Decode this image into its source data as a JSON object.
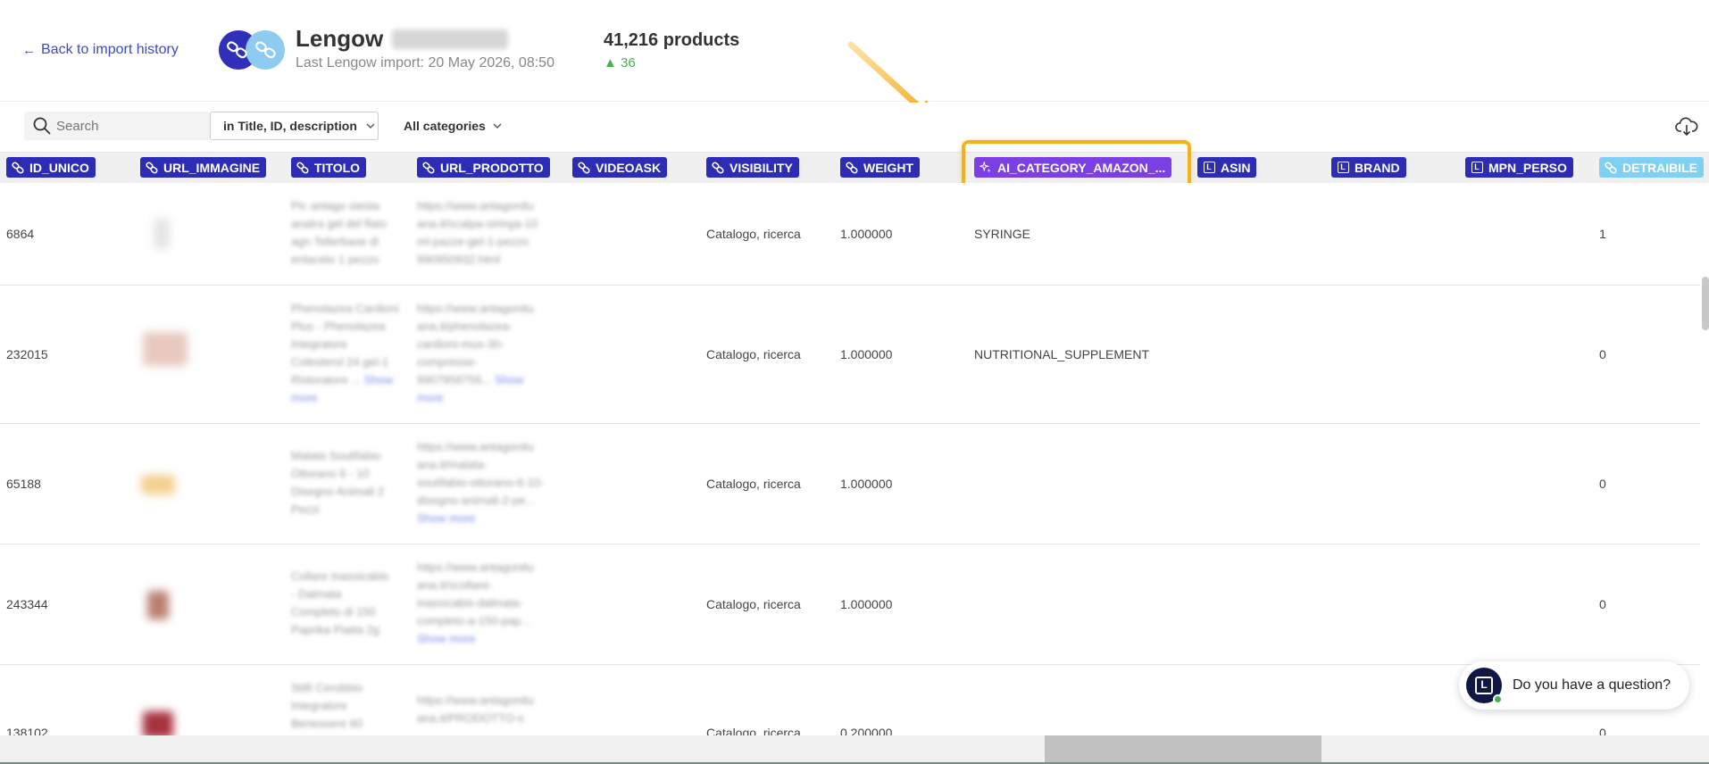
{
  "header": {
    "back_label": "Back to import history",
    "store_name": "Lengow",
    "last_import": "Last Lengow import: 20 May 2026, 08:50",
    "products_count": "41,216 products",
    "delta": "▲ 36"
  },
  "filters": {
    "search_placeholder": "Search",
    "scope_value": "in Title, ID, description",
    "category_value": "All categories"
  },
  "columns": [
    {
      "label": "ID_UNICO",
      "icon": "link-icon"
    },
    {
      "label": "URL_IMMAGINE",
      "icon": "link-icon"
    },
    {
      "label": "TITOLO",
      "icon": "link-icon"
    },
    {
      "label": "URL_PRODOTTO",
      "icon": "link-icon"
    },
    {
      "label": "VIDEOASK",
      "icon": "link-icon"
    },
    {
      "label": "VISIBILITY",
      "icon": "link-icon"
    },
    {
      "label": "WEIGHT",
      "icon": "link-icon"
    },
    {
      "label": "AI_CATEGORY_AMAZON_...",
      "icon": "sparkle-icon"
    },
    {
      "label": "ASIN",
      "icon": "lengow-l-icon"
    },
    {
      "label": "BRAND",
      "icon": "lengow-l-icon"
    },
    {
      "label": "MPN_PERSO",
      "icon": "lengow-l-icon"
    },
    {
      "label": "DETRAIBILE",
      "icon": "link-icon"
    }
  ],
  "rows": [
    {
      "id": "6864",
      "visibility": "Catalogo, ricerca",
      "weight": "1.000000",
      "ai_category": "SYRINGE",
      "detraibile": "1"
    },
    {
      "id": "232015",
      "visibility": "Catalogo, ricerca",
      "weight": "1.000000",
      "ai_category": "NUTRITIONAL_SUPPLEMENT",
      "detraibile": "0"
    },
    {
      "id": "65188",
      "visibility": "Catalogo, ricerca",
      "weight": "1.000000",
      "ai_category": "",
      "detraibile": "0"
    },
    {
      "id": "243344",
      "visibility": "Catalogo, ricerca",
      "weight": "1.000000",
      "ai_category": "",
      "detraibile": "0"
    },
    {
      "id": "138102",
      "visibility": "Catalogo, ricerca",
      "weight": "0.200000",
      "ai_category": "",
      "detraibile": "0"
    }
  ],
  "chat": {
    "label": "Do you have a question?"
  },
  "colors": {
    "chip": "#2c2cb5",
    "chip_ai": "#7b3fe4",
    "highlight": "#f3b21b",
    "link": "#3b4cc0",
    "delta": "#4caf50"
  }
}
